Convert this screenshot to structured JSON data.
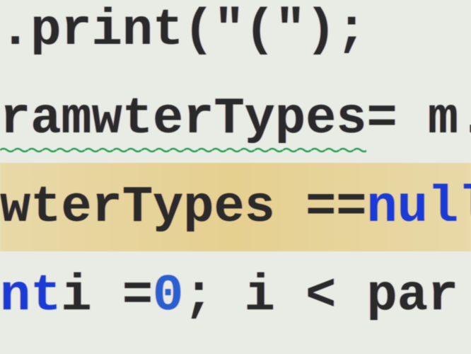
{
  "code": {
    "line1": {
      "p1": ".print(",
      "str": "\"(\"",
      "p2": ");"
    },
    "line2": {
      "ident": "ramwterTypes",
      "rest": " = m."
    },
    "line3": {
      "lhs": "wterTypes == ",
      "null": "null"
    },
    "line4": {
      "kw_frag": "nt",
      "p1": " i = ",
      "zero": "0",
      "p2": "; i < par"
    }
  }
}
